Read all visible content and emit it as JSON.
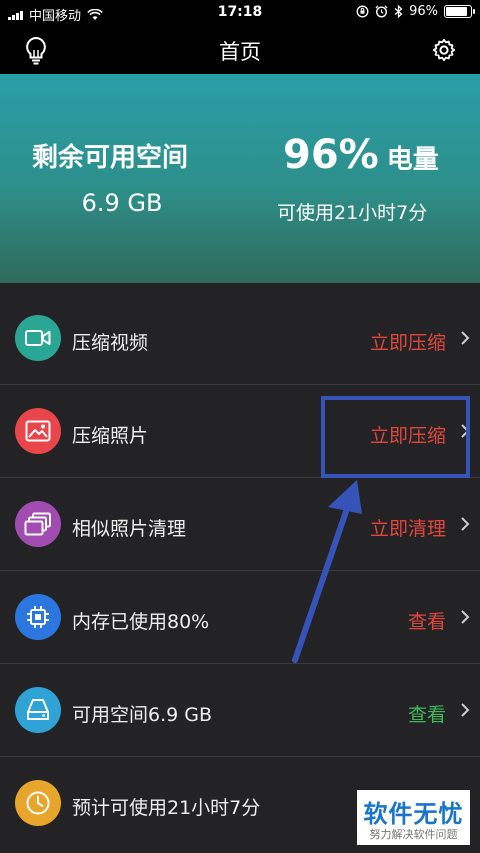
{
  "status_bar": {
    "carrier": "中国移动",
    "time": "17:18",
    "battery_text": "96%",
    "battery_level": 0.96
  },
  "navbar": {
    "title": "首页"
  },
  "hero": {
    "space_label": "剩余可用空间",
    "space_value": "6.9 GB",
    "battery_percent": "96%",
    "battery_label": "电量",
    "battery_time": "可使用21小时7分"
  },
  "list": [
    {
      "label": "压缩视频",
      "action": "立即压缩",
      "icon": "video-icon",
      "icon_color": "#2aa794",
      "action_color": "#e0463c"
    },
    {
      "label": "压缩照片",
      "action": "立即压缩",
      "icon": "photo-icon",
      "icon_color": "#e8464a",
      "action_color": "#e0463c"
    },
    {
      "label": "相似照片清理",
      "action": "立即清理",
      "icon": "similar-photos-icon",
      "icon_color": "#a14cb0",
      "action_color": "#e0463c"
    },
    {
      "label": "内存已使用80%",
      "action": "查看",
      "icon": "chip-icon",
      "icon_color": "#2c76e0",
      "action_color": "#e0463c"
    },
    {
      "label": "可用空间6.9 GB",
      "action": "查看",
      "icon": "storage-icon",
      "icon_color": "#2fa3d6",
      "action_color": "#3fb85a"
    },
    {
      "label": "预计可使用21小时7分",
      "action": "",
      "icon": "clock-icon",
      "icon_color": "#e8a52c",
      "action_color": "#e0463c"
    }
  ],
  "watermark": {
    "title": "软件无忧",
    "subtitle": "努力解决软件问题"
  },
  "colors": {
    "hero_gradient_top": "#2a9ea8",
    "hero_gradient_bottom": "#2f6a5a",
    "highlight_border": "#3553b8",
    "arrow": "#3553b8"
  }
}
